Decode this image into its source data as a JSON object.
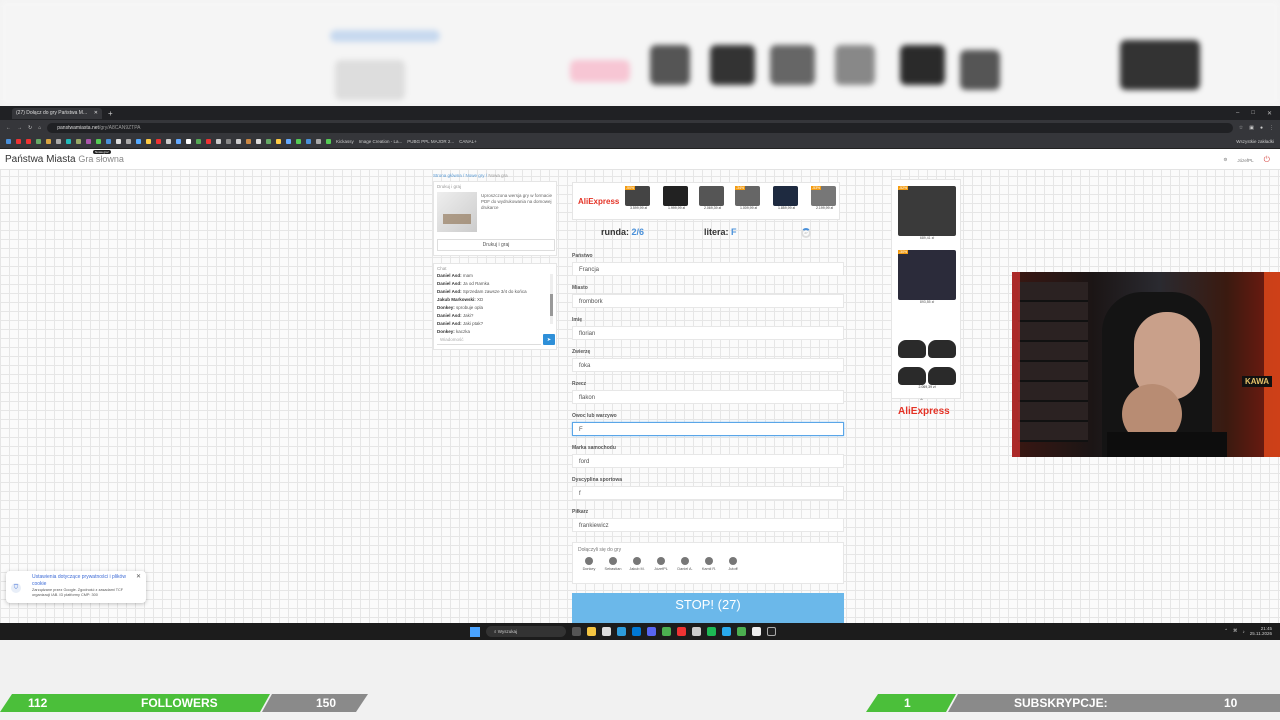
{
  "browser": {
    "tab_title": "(27) Dołącz do gry Państwa M...",
    "url_domain": "panstwamiasta.net",
    "url_path": "/gry/A8CAN9ZTPA",
    "bookmarks": [
      "Kickassy",
      "Image Creation - La...",
      "PUBG PPL MAJOR 2...",
      "CANAL+"
    ],
    "bookmarks_right": "Wszystkie zakładki"
  },
  "site": {
    "logo": "Państwa Miasta",
    "logo_sub": "Gra słowna",
    "logo_badge": "Nowa gra!",
    "user": "JózefPL",
    "breadcrumb": [
      "Strona główna",
      "Nowe gry",
      "Nowa gra"
    ]
  },
  "print_card": {
    "header": "Drukuj i graj",
    "text": "Uproszczona wersja gry w formacie PDF do wydrukowania na domowej drukarce",
    "button": "Drukuj i graj"
  },
  "chat": {
    "header": "Chat",
    "messages": [
      {
        "user": "Daniel Asd:",
        "text": "mam"
      },
      {
        "user": "Daniel Asd:",
        "text": "Ja od Ramka"
      },
      {
        "user": "Daniel Asd:",
        "text": "Sprzedam zawsze 3/4 do końca"
      },
      {
        "user": "Jakub Markowski:",
        "text": "XD"
      },
      {
        "user": "Donkey:",
        "text": "sprobuje opla"
      },
      {
        "user": "Daniel Asd:",
        "text": "Jaki?"
      },
      {
        "user": "Daniel Asd:",
        "text": "Jaki ptak?"
      },
      {
        "user": "Donkey:",
        "text": "kaczka"
      }
    ],
    "placeholder": "Wiadomość"
  },
  "ad_top": {
    "brand": "AliExpress",
    "products": [
      {
        "discount": "-50%",
        "price": "3.599,99 zł"
      },
      {
        "discount": "",
        "price": "1.999,99 zł"
      },
      {
        "discount": "",
        "price": "2.069,39 zł"
      },
      {
        "discount": "-34%",
        "price": "1.009,99 zł"
      },
      {
        "discount": "",
        "price": "1.859,99 zł"
      },
      {
        "discount": "-53%",
        "price": "2.199,99 zł"
      }
    ]
  },
  "game": {
    "round_label": "runda:",
    "round_value": "2/6",
    "letter_label": "litera:",
    "letter_value": "F",
    "timer": "27",
    "fields": [
      {
        "label": "Państwo",
        "value": "Francja"
      },
      {
        "label": "Miasto",
        "value": "frombork"
      },
      {
        "label": "Imię",
        "value": "florian"
      },
      {
        "label": "Zwierzę",
        "value": "foka"
      },
      {
        "label": "Rzecz",
        "value": "flakon"
      },
      {
        "label": "Owoc lub warzywo",
        "value": "F"
      },
      {
        "label": "Marka samochodu",
        "value": "ford"
      },
      {
        "label": "Dyscyplina sportowa",
        "value": "f"
      },
      {
        "label": "Piłkarz",
        "value": "frankiewicz"
      }
    ],
    "players_header": "Dołączyli się do gry",
    "players": [
      "Donkey",
      "Sebastian",
      "Jakub M.",
      "JózefPL",
      "Daniel A.",
      "Kamil R.",
      "Jutoff"
    ],
    "stop_button": "STOP! (27)"
  },
  "ad_right": {
    "products": [
      {
        "discount": "-52%",
        "price": "689,41 zł"
      },
      {
        "discount": "-30%",
        "price": "893,55 zł"
      }
    ],
    "wheels_price": "2.069,39 zł",
    "brand": "AliExpress"
  },
  "cookie": {
    "title": "Ustawienia dotyczące prywatności i plików cookie",
    "text": "Zarządzane przez Google. Zgodność z zasadami TCF organizacji IAB. ID platformy CMP: 300"
  },
  "taskbar": {
    "search": "Wyszukaj",
    "time": "21:45",
    "date": "25.11.2026"
  },
  "overlay": {
    "followers_current": "112",
    "followers_label": "FOLLOWERS",
    "followers_goal": "150",
    "subs_current": "1",
    "subs_label": "SUBSKRYPCJE:",
    "subs_goal": "10"
  },
  "webcam": {
    "sign": "KAWA"
  }
}
